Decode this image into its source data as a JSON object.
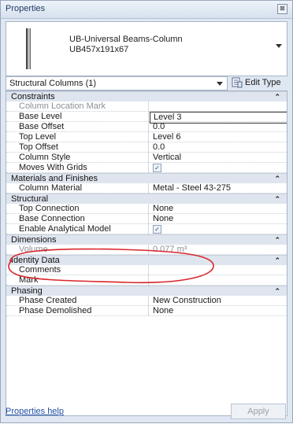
{
  "window": {
    "title": "Properties",
    "close_glyph": "⊠"
  },
  "type_selector": {
    "name_line1": "UB-Universal Beams-Column",
    "name_line2": "UB457x191x67"
  },
  "instance_filter": {
    "label": "Structural Columns (1)",
    "edit_type_label": "Edit Type"
  },
  "groups": [
    {
      "label": "Constraints",
      "rows": [
        {
          "name": "Column Location Mark",
          "value": "",
          "readonly": true
        },
        {
          "name": "Base Level",
          "value": "Level 3",
          "editing": true
        },
        {
          "name": "Base Offset",
          "value": "0.0"
        },
        {
          "name": "Top Level",
          "value": "Level 6"
        },
        {
          "name": "Top Offset",
          "value": "0.0"
        },
        {
          "name": "Column Style",
          "value": "Vertical"
        },
        {
          "name": "Moves With Grids",
          "checkbox": true,
          "checked": true
        }
      ]
    },
    {
      "label": "Materials and Finishes",
      "rows": [
        {
          "name": "Column Material",
          "value": "Metal - Steel 43-275"
        }
      ]
    },
    {
      "label": "Structural",
      "rows": [
        {
          "name": "Top Connection",
          "value": "None"
        },
        {
          "name": "Base Connection",
          "value": "None"
        },
        {
          "name": "Enable Analytical Model",
          "checkbox": true,
          "checked": true
        }
      ]
    },
    {
      "label": "Dimensions",
      "rows": [
        {
          "name": "Volume",
          "value": "0.077 m³",
          "readonly": true
        }
      ]
    },
    {
      "label": "Identity Data",
      "rows": [
        {
          "name": "Comments",
          "value": ""
        },
        {
          "name": "Mark",
          "value": ""
        }
      ]
    },
    {
      "label": "Phasing",
      "rows": [
        {
          "name": "Phase Created",
          "value": "New Construction"
        },
        {
          "name": "Phase Demolished",
          "value": "None"
        }
      ]
    }
  ],
  "footer": {
    "help_link": "Properties help",
    "apply_label": "Apply"
  },
  "annotation": {
    "color": "#d9262b"
  }
}
